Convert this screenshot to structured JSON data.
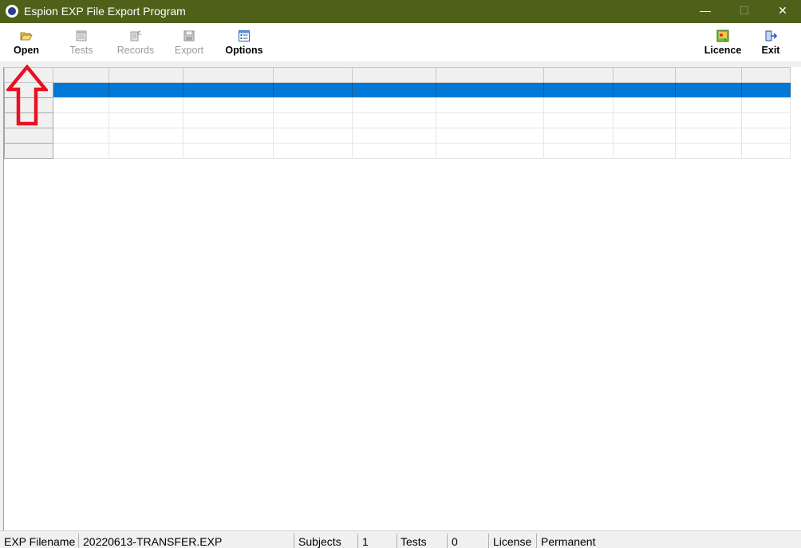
{
  "window": {
    "title": "Espion EXP File Export Program",
    "minimize_glyph": "—",
    "maximize_glyph": "☐",
    "close_glyph": "✕"
  },
  "toolbar": {
    "open_label": "Open",
    "tests_label": "Tests",
    "records_label": "Records",
    "export_label": "Export",
    "options_label": "Options",
    "licence_label": "Licence",
    "exit_label": "Exit"
  },
  "grid": {
    "rows": 6,
    "columns": 10,
    "selected_row": 1
  },
  "statusbar": {
    "filename_label": "EXP Filename",
    "filename_value": "20220613-TRANSFER.EXP",
    "subjects_label": "Subjects",
    "subjects_value": "1",
    "tests_label": "Tests",
    "tests_value": "0",
    "license_label": "License",
    "license_value": "Permanent"
  },
  "colors": {
    "titlebar": "#4f6119",
    "selection": "#0078d7",
    "annotation_arrow": "#e81123"
  }
}
